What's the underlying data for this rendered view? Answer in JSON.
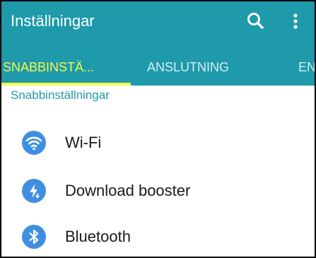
{
  "appbar": {
    "title": "Inställningar",
    "background_color": "#1e9aaa",
    "actions": [
      "search-icon",
      "more-vert-icon"
    ]
  },
  "tabs": [
    {
      "label": "SNABBINSTÄ...",
      "active": true
    },
    {
      "label": "ANSLUTNING",
      "active": false
    },
    {
      "label": "ENH",
      "active": false
    }
  ],
  "tab_indicator_color": "#f4f84a",
  "section": {
    "header": "Snabbinställningar"
  },
  "settings": [
    {
      "label": "Wi-Fi",
      "icon": "wifi-icon",
      "icon_color": "#3f8fe0"
    },
    {
      "label": "Download booster",
      "icon": "download-booster-icon",
      "icon_color": "#3f8fe0"
    },
    {
      "label": "Bluetooth",
      "icon": "bluetooth-icon",
      "icon_color": "#3f8fe0"
    }
  ]
}
